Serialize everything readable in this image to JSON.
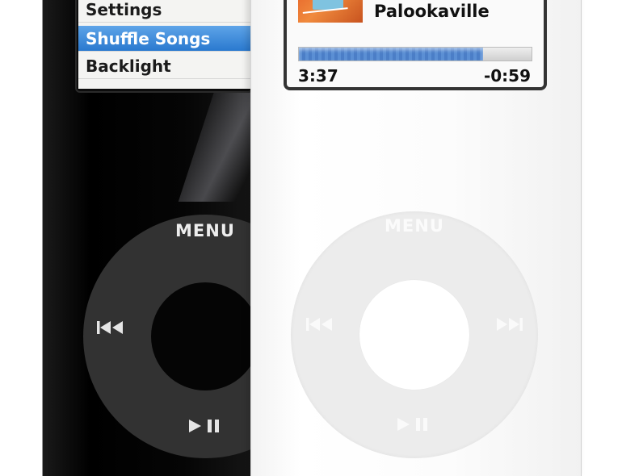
{
  "black_ipod": {
    "menu": {
      "items": [
        {
          "label": "Settings"
        },
        {
          "label": "Shuffle Songs"
        },
        {
          "label": "Backlight"
        }
      ]
    },
    "wheel": {
      "menu_label": "MENU",
      "prev_icon": "previous-track-icon",
      "play_pause_icon": "play-pause-icon"
    }
  },
  "white_ipod": {
    "now_playing": {
      "title": "Palookaville",
      "elapsed": "3:37",
      "remaining": "-0:59",
      "progress_fraction": 0.79
    },
    "wheel": {
      "menu_label": "MENU",
      "prev_icon": "previous-track-icon",
      "next_icon": "next-track-icon",
      "play_pause_icon": "play-pause-icon"
    }
  },
  "colors": {
    "selection_blue": "#3b86d8",
    "progress_blue": "#4f85cc",
    "black_wheel": "#323232",
    "white_wheel": "#ececec"
  }
}
